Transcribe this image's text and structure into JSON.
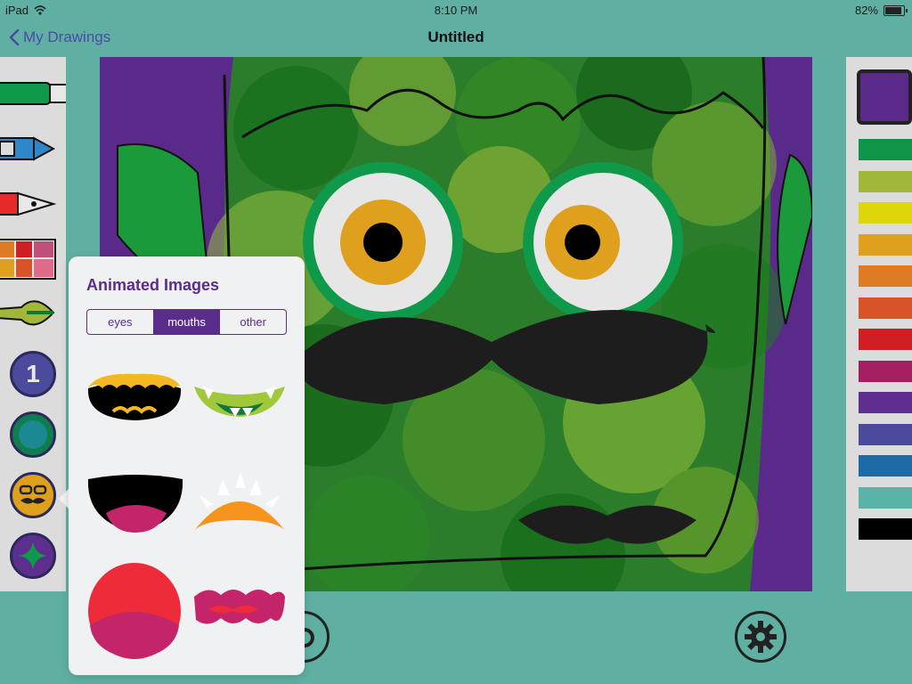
{
  "status_bar": {
    "device": "iPad",
    "time": "8:10 PM",
    "battery": "82%"
  },
  "nav": {
    "back_label": "My Drawings",
    "title": "Untitled"
  },
  "left_tools": [
    {
      "name": "marker-icon"
    },
    {
      "name": "crayon-icon"
    },
    {
      "name": "pen-icon"
    },
    {
      "name": "paint-palette-icon"
    },
    {
      "name": "brush-icon"
    },
    {
      "name": "brush-size-icon",
      "label": "1"
    },
    {
      "name": "fill-color-icon"
    },
    {
      "name": "stickers-icon"
    },
    {
      "name": "stamp-icon"
    }
  ],
  "palette": {
    "selected": "#5a2a8a",
    "colors": [
      "#0e9548",
      "#a1b739",
      "#ddd60a",
      "#dfa11d",
      "#df7b22",
      "#d9532a",
      "#cf1f25",
      "#a31f5f",
      "#5e2e8e",
      "#4b4a9c",
      "#1e6aa6",
      "#59b3a7",
      "#000000"
    ]
  },
  "popover": {
    "title": "Animated Images",
    "tabs": [
      "eyes",
      "mouths",
      "other"
    ],
    "active_tab": "mouths",
    "items": [
      "yellow-teeth-mouth",
      "green-fang-mouth",
      "open-black-mouth",
      "orange-sun-mouth",
      "red-open-mouth",
      "pink-wavy-mouth"
    ]
  },
  "bottom_controls": {
    "settings": "gear-icon"
  },
  "colors": {
    "background": "#5fb0a2",
    "accent": "#5a2d8c",
    "canvas_bg": "#5a2a8a"
  }
}
